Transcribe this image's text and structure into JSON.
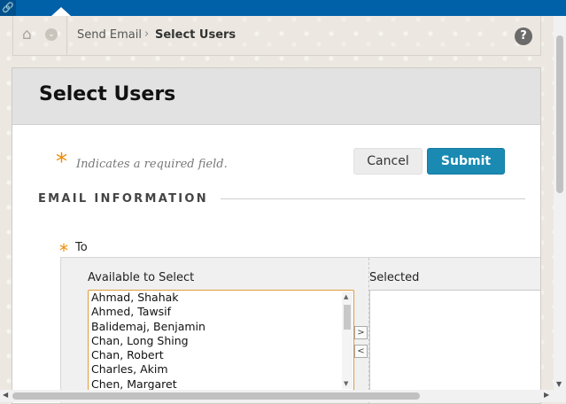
{
  "topbar": {
    "link_icon": "🔗"
  },
  "breadcrumb": {
    "home_icon": "⌂",
    "chevron_icon": "⌄",
    "items": [
      "Send Email",
      "Select Users"
    ],
    "separator": "›",
    "help": "?"
  },
  "page": {
    "title": "Select Users",
    "required_marker": "*",
    "required_note": "Indicates a required field.",
    "cancel_label": "Cancel",
    "submit_label": "Submit"
  },
  "email_information": {
    "section_title": "EMAIL INFORMATION",
    "to_label": "To",
    "available_label": "Available to Select",
    "selected_label": "Selected",
    "available": [
      "Ahmad, Shahak",
      "Ahmed, Tawsif",
      "Balidemaj, Benjamin",
      "Chan, Long Shing",
      "Chan, Robert",
      "Charles, Akim",
      "Chen, Margaret"
    ],
    "selected": [],
    "move_right": ">",
    "move_left": "<"
  }
}
